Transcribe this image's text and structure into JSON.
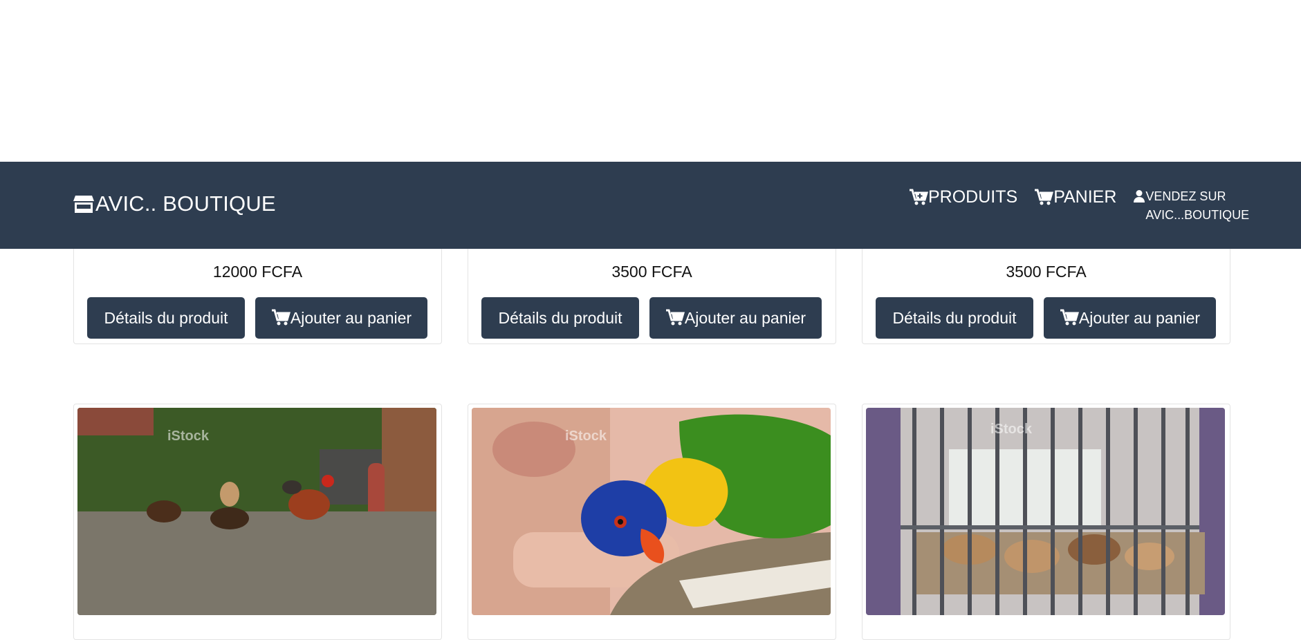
{
  "brand": {
    "name": "AVIC.. BOUTIQUE",
    "icon": "store-icon"
  },
  "nav": {
    "products": {
      "label": "PRODUITS",
      "icon": "cart-plus-icon"
    },
    "cart": {
      "label": "PANIER",
      "icon": "cart-icon"
    },
    "sell": {
      "label": "VENDEZ SUR AVIC...BOUTIQUE",
      "icon": "user-icon"
    }
  },
  "products_row1": [
    {
      "price": "12000 FCFA",
      "details_label": "Détails du produit",
      "add_label": "Ajouter au panier"
    },
    {
      "price": "3500 FCFA",
      "details_label": "Détails du produit",
      "add_label": "Ajouter au panier"
    },
    {
      "price": "3500 FCFA",
      "details_label": "Détails du produit",
      "add_label": "Ajouter au panier"
    }
  ],
  "products_row2": [
    {
      "image": "chickens-in-yard",
      "watermark": "iStock"
    },
    {
      "image": "rainbow-lorikeet-parrot",
      "watermark": "iStock"
    },
    {
      "image": "chickens-in-cage",
      "watermark": "iStock"
    }
  ],
  "colors": {
    "navbar": "#2e3d50",
    "button": "#2e3d50",
    "text_on_dark": "#ffffff"
  }
}
